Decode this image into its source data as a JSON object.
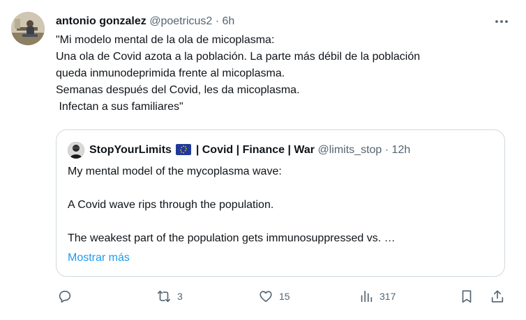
{
  "post": {
    "author_name": "antonio gonzalez",
    "author_handle": "@poetricus2",
    "separator": "·",
    "time": "6h",
    "more_icon": "more-horizontal-icon",
    "text_lines": [
      "\"Mi modelo mental de la ola de micoplasma:",
      "Una ola de Covid azota a la población. La parte más débil de la población",
      "queda inmunodeprimida frente al micoplasma.",
      "Semanas después del Covid, les da micoplasma.",
      " Infectan a sus familiares\""
    ]
  },
  "quote": {
    "author_name_part1": "StopYourLimits",
    "flag_icon": "eu-flag-icon",
    "author_name_part2": "| Covid | Finance | War",
    "author_handle": "@limits_stop",
    "separator": "·",
    "time": "12h",
    "paragraphs": [
      "My mental model of the mycoplasma wave:",
      "A Covid wave rips through the population.",
      "The weakest part of the population gets immunosuppressed vs. …"
    ],
    "show_more_label": "Mostrar más"
  },
  "actions": {
    "reply": {
      "icon": "reply-icon",
      "count": ""
    },
    "repost": {
      "icon": "repost-icon",
      "count": "3"
    },
    "like": {
      "icon": "heart-icon",
      "count": "15"
    },
    "views": {
      "icon": "views-icon",
      "count": "317"
    },
    "bookmark": {
      "icon": "bookmark-icon"
    },
    "share": {
      "icon": "share-icon"
    }
  },
  "colors": {
    "text": "#0f1419",
    "secondary": "#536471",
    "link": "#1d9bf0",
    "border": "#cfd9de"
  }
}
